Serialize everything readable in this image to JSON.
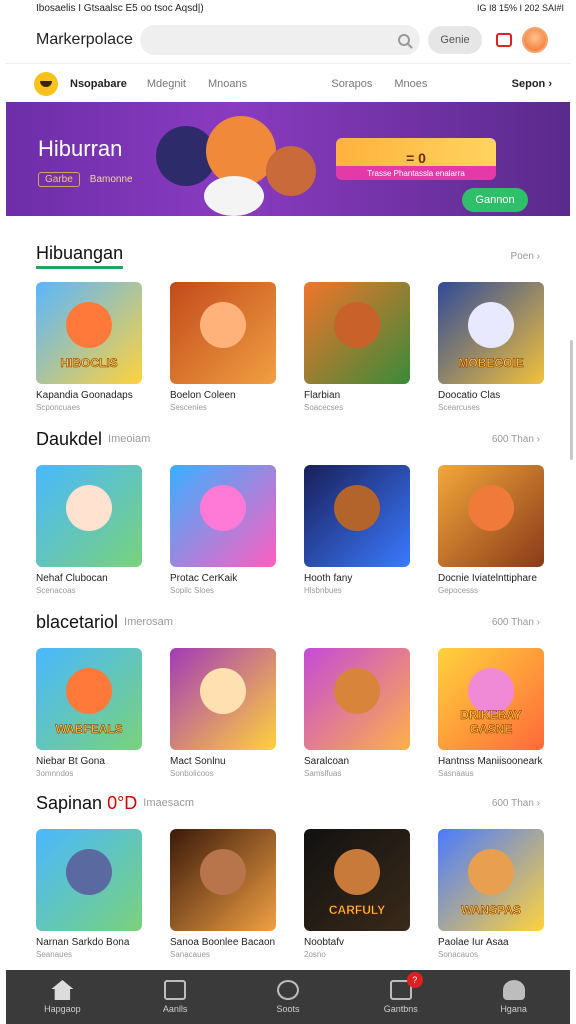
{
  "status": {
    "left": "Ibosaelis I Gtsaalsc E5 oo tsoc Aqsd|)",
    "right": "IG I8 15% I 202 SAI#I"
  },
  "header": {
    "brand": "Markerpolace",
    "search_placeholder": "",
    "game_button": "Genie"
  },
  "categories": {
    "first": "Nsopabare",
    "items": [
      "Mdegnit",
      "Mnoans",
      "Sorapos",
      "Mnoes"
    ],
    "last": "Sepon ›"
  },
  "hero": {
    "title": "Hiburran",
    "tag": "Garbe",
    "sub": "Bamonne",
    "card_value": "= 0",
    "card_bar": "Trasse Phantassla enalarra",
    "button": "Gannon"
  },
  "sections": [
    {
      "title": "Hibuangan",
      "subtitle": "",
      "more": "Poen ›",
      "items": [
        {
          "title": "Kapandia Goonadaps",
          "sub": "Scponcuaes",
          "thumb_text": "HIBOCLIS",
          "c1": "#59b6ff",
          "c2": "#ffd23c",
          "face": "#ff7a3a"
        },
        {
          "title": "Boelon Coleen",
          "sub": "Sescenies",
          "thumb_text": "",
          "c1": "#c24a1b",
          "c2": "#f0a043",
          "face": "#ffb27a"
        },
        {
          "title": "Flarbian",
          "sub": "Soacecses",
          "thumb_text": "",
          "c1": "#f2742c",
          "c2": "#3a8a3a",
          "face": "#c8622a"
        },
        {
          "title": "Doocatio Clas",
          "sub": "Scearcuses",
          "thumb_text": "MOBECOIE",
          "c1": "#2f4a9a",
          "c2": "#f2c13a",
          "face": "#e8e8ff"
        }
      ]
    },
    {
      "title": "Daukdel",
      "subtitle": "Imeoiam",
      "more": "600 Than ›",
      "items": [
        {
          "title": "Nehaf Clubocan",
          "sub": "Scenacoas",
          "thumb_text": "",
          "c1": "#4ab8ff",
          "c2": "#7ad27a",
          "face": "#ffe2d0"
        },
        {
          "title": "Protac CerKaik",
          "sub": "Sopilc Sloes",
          "thumb_text": "",
          "c1": "#3ab0ff",
          "c2": "#ff5ec0",
          "face": "#ff7ad6"
        },
        {
          "title": "Hooth fany",
          "sub": "Hlsbnbues",
          "thumb_text": "",
          "c1": "#1a1f5a",
          "c2": "#3a7aff",
          "face": "#b2642a"
        },
        {
          "title": "Docnie Iviatelnttiphare",
          "sub": "Gepocesss",
          "thumb_text": "",
          "c1": "#f2a83a",
          "c2": "#8a3a1a",
          "face": "#f07a3a"
        }
      ]
    },
    {
      "title": "blacetariol",
      "subtitle": "Imerosam",
      "more": "600 Than ›",
      "items": [
        {
          "title": "Niebar Bt Gona",
          "sub": "3omnndos",
          "thumb_text": "WABFEALS",
          "c1": "#4ab8ff",
          "c2": "#7ad27a",
          "face": "#ff7a3a"
        },
        {
          "title": "Mact Sonlnu",
          "sub": "Sonbolicoos",
          "thumb_text": "",
          "c1": "#a33ab8",
          "c2": "#ffd23c",
          "face": "#ffe0b0"
        },
        {
          "title": "Saralcoan",
          "sub": "Samslfuas",
          "thumb_text": "",
          "c1": "#c44ad8",
          "c2": "#ffb04a",
          "face": "#d8843a"
        },
        {
          "title": "Hantnss Maniisooneark",
          "sub": "Sasnaaus",
          "thumb_text": "DRIKEBAY GASNE",
          "c1": "#ffd23c",
          "c2": "#ff6a3a",
          "face": "#f08ad6"
        }
      ]
    },
    {
      "title": "Sapinan",
      "title_accent": "0°D",
      "subtitle": "Imaesacm",
      "more": "600 Than ›",
      "items": [
        {
          "title": "Narnan Sarkdo Bona",
          "sub": "Seanaues",
          "thumb_text": "",
          "c1": "#4ab8ff",
          "c2": "#7ad27a",
          "face": "#5a6aa0"
        },
        {
          "title": "Sanoa Boonlee Bacaon",
          "sub": "Sanacaues",
          "thumb_text": "",
          "c1": "#3a1a0a",
          "c2": "#f0a043",
          "face": "#b8744a"
        },
        {
          "title": "Noobtafv",
          "sub": "2osno",
          "thumb_text": "CARFULY",
          "c1": "#111111",
          "c2": "#3a2a1a",
          "face": "#c87a3a"
        },
        {
          "title": "Paolae Iur Asaa",
          "sub": "Sonacauos",
          "thumb_text": "WANSPAS",
          "c1": "#4a7aff",
          "c2": "#ffd23c",
          "face": "#e8a050"
        }
      ]
    }
  ],
  "bottom_nav": [
    {
      "label": "Hapgaop",
      "icon": "home-icon"
    },
    {
      "label": "Aanlls",
      "icon": "apps-icon"
    },
    {
      "label": "Soots",
      "icon": "games-icon"
    },
    {
      "label": "Gantbns",
      "icon": "books-icon",
      "badge": "?"
    },
    {
      "label": "Hgana",
      "icon": "profile-icon"
    }
  ]
}
